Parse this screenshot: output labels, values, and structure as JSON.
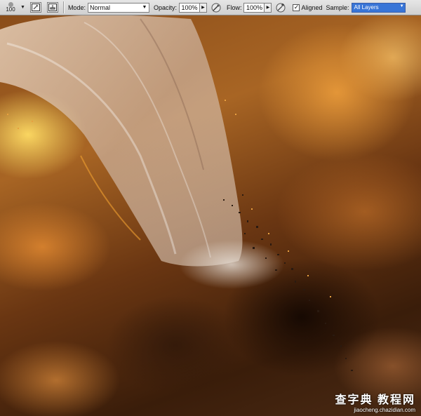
{
  "toolbar": {
    "brush_size": "100",
    "mode_label": "Mode:",
    "mode_value": "Normal",
    "opacity_label": "Opacity:",
    "opacity_value": "100%",
    "flow_label": "Flow:",
    "flow_value": "100%",
    "aligned_label": "Aligned",
    "aligned_checked": "✓",
    "sample_label": "Sample:",
    "sample_value": "All Layers"
  },
  "watermark": {
    "line1": "查字典 教程网",
    "line2": "jiaocheng.chazidian.com"
  },
  "colors": {
    "toolbar_bg": "#d9d9d9",
    "selection_blue": "#3875d7"
  }
}
